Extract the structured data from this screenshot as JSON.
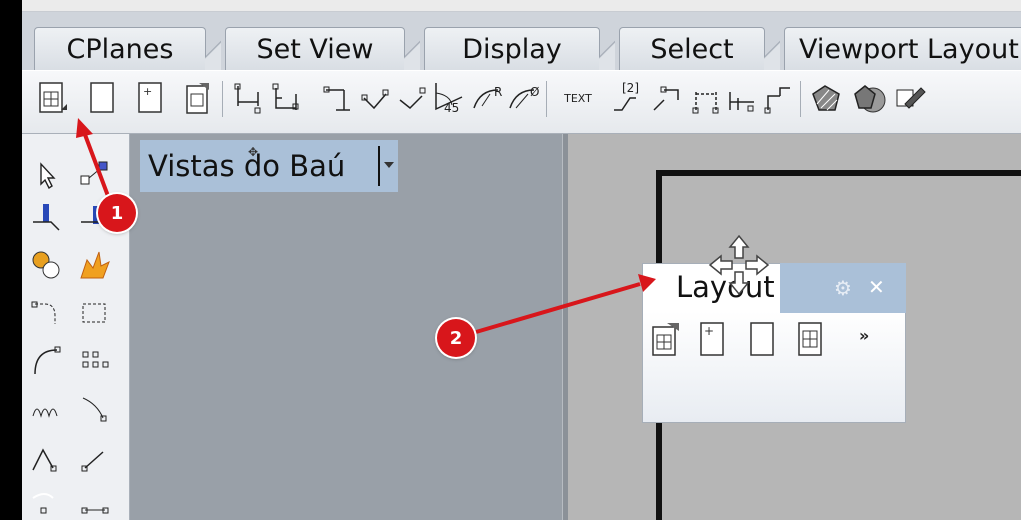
{
  "tabs": [
    {
      "label": "CPlanes"
    },
    {
      "label": "Set View"
    },
    {
      "label": "Display"
    },
    {
      "label": "Select"
    },
    {
      "label": "Viewport Layout"
    }
  ],
  "toolbar": {
    "text_tool_label": "TEXT",
    "dim_angle_label": "45",
    "dim_radius_label": "R",
    "dim_diameter_label": "Ø",
    "leader_number_label": "[2]"
  },
  "vistas_panel": {
    "title": "Vistas do Baú"
  },
  "layout_panel": {
    "title": "Layout",
    "more_label": "»"
  },
  "annotations": [
    {
      "number": "1"
    },
    {
      "number": "2"
    }
  ],
  "colors": {
    "annotation_red": "#d8161b",
    "panel_tab_blue": "#aac0d8",
    "grey_panel": "#99a0a8",
    "viewport_bg": "#b6b6b6"
  }
}
